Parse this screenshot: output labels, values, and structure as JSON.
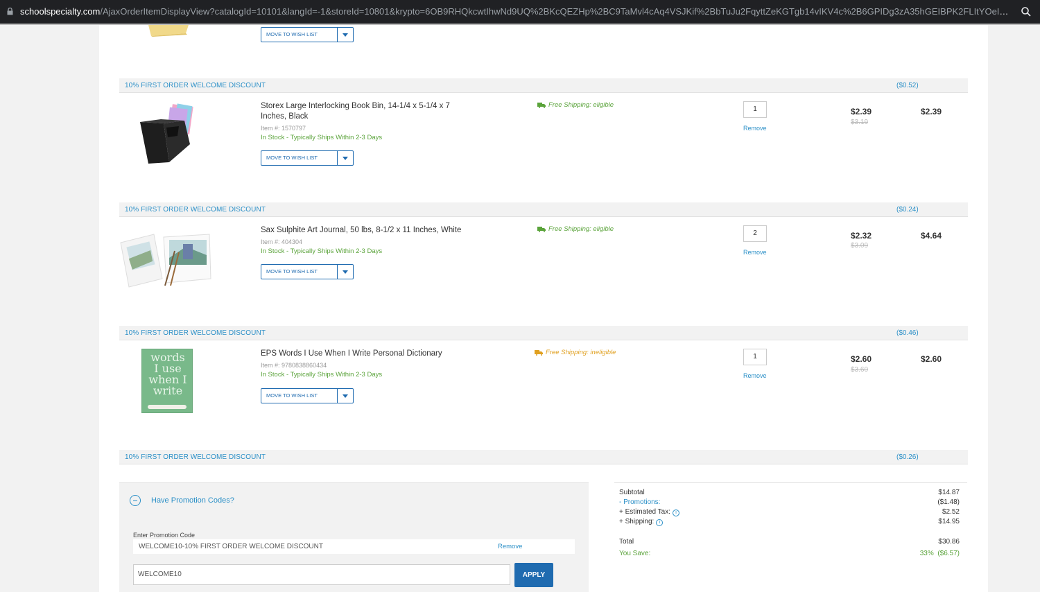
{
  "browser": {
    "url_host": "schoolspecialty.com",
    "url_path": "/AjaxOrderItemDisplayView?catalogId=10101&langId=-1&storeId=10801&krypto=6OB9RHQkcwtIhwNd9UQ%2BKcQEZHp%2BC9TaMvl4cAq4VSJKif%2BbTuJu2FqyttZeKGTgb14vIKV4c%2B6GPIDg3zA35hGEIBPK2FLItYOeIHtgbQ..."
  },
  "top_item": {
    "wish_label": "MOVE TO WISH LIST"
  },
  "discount_label": "10% FIRST ORDER WELCOME DISCOUNT",
  "discounts": [
    "($0.52)",
    "($0.24)",
    "($0.46)",
    "($0.26)"
  ],
  "items": [
    {
      "name": "Storex Large Interlocking Book Bin, 14-1/4 x 5-1/4 x 7 Inches, Black",
      "item_no": "Item #: 1570797",
      "stock": "In Stock - Typically Ships Within 2-3 Days",
      "wish_label": "MOVE TO WISH LIST",
      "shipping": "Free Shipping: eligible",
      "qty": "1",
      "remove": "Remove",
      "price": "$2.39",
      "old_price": "$3.19",
      "total": "$2.39"
    },
    {
      "name": "Sax Sulphite Art Journal, 50 lbs, 8-1/2 x 11 Inches, White",
      "item_no": "Item #: 404304",
      "stock": "In Stock - Typically Ships Within 2-3 Days",
      "wish_label": "MOVE TO WISH LIST",
      "shipping": "Free Shipping: eligible",
      "qty": "2",
      "remove": "Remove",
      "price": "$2.32",
      "old_price": "$3.09",
      "total": "$4.64"
    },
    {
      "name": "EPS Words I Use When I Write Personal Dictionary",
      "item_no": "Item #: 9780838860434",
      "stock": "In Stock - Typically Ships Within 2-3 Days",
      "wish_label": "MOVE TO WISH LIST",
      "shipping": "Free Shipping: ineligible",
      "qty": "1",
      "remove": "Remove",
      "price": "$2.60",
      "old_price": "$3.60",
      "total": "$2.60"
    }
  ],
  "book_cover_text": [
    "words",
    "I use",
    "when I",
    "write"
  ],
  "promo": {
    "header": "Have Promotion Codes?",
    "enter_label": "Enter Promotion Code",
    "applied_code": "WELCOME10-10% FIRST ORDER WELCOME DISCOUNT",
    "applied_remove": "Remove",
    "input_value": "WELCOME10",
    "apply_label": "APPLY"
  },
  "summary": {
    "subtotal_label": "Subtotal",
    "subtotal": "$14.87",
    "promotions_prefix": "- ",
    "promotions_label": "Promotions:",
    "promotions": "($1.48)",
    "tax_label": "+ Estimated Tax:",
    "tax": "$2.52",
    "shipping_label": "+ Shipping:",
    "shipping": "$14.95",
    "total_label": "Total",
    "total": "$30.86",
    "save_label": "You Save:",
    "save_pct": "33%",
    "save_amt": "($6.57)"
  },
  "colors": {
    "link": "#2a8fc7",
    "button": "#1f6bb0",
    "green": "#5aa33a",
    "ineligible": "#e0a020"
  }
}
